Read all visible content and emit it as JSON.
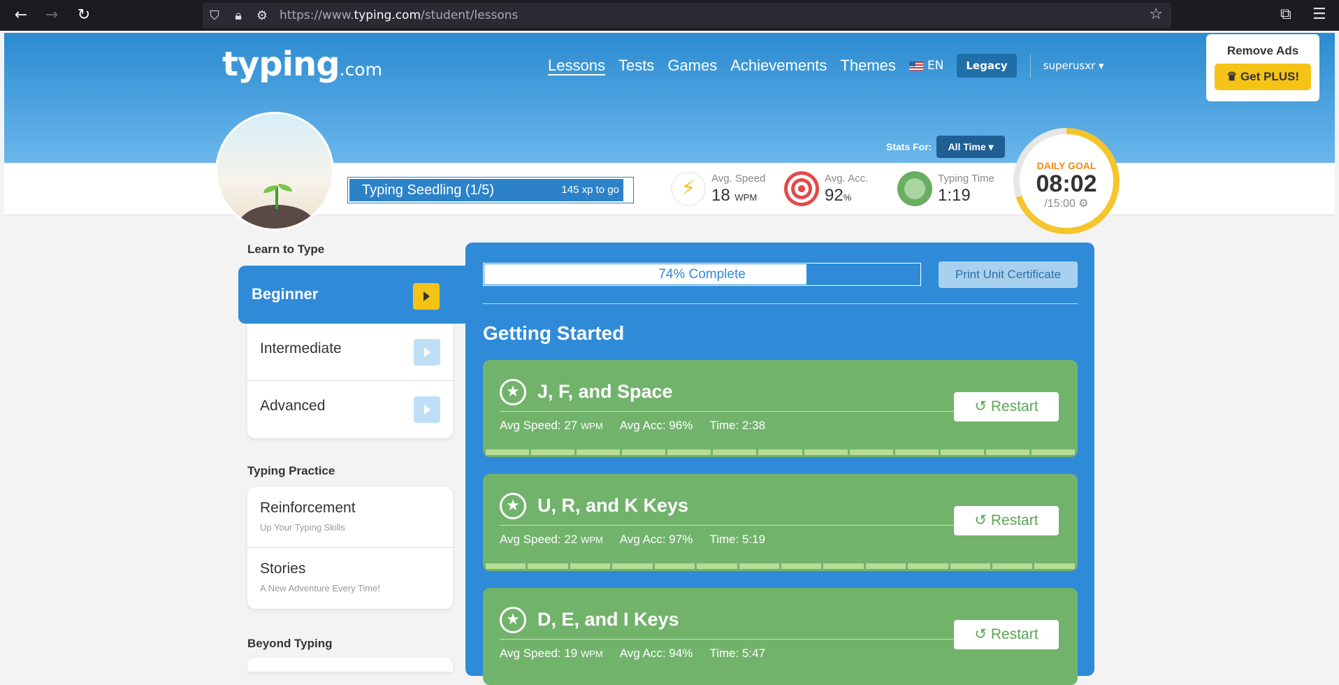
{
  "browser": {
    "url_prefix": "https://www.",
    "url_domain": "typing.com",
    "url_path": "/student/lessons"
  },
  "header": {
    "logo_main": "typing",
    "logo_suffix": ".com",
    "nav": [
      "Lessons",
      "Tests",
      "Games",
      "Achievements",
      "Themes"
    ],
    "lang": "EN",
    "legacy": "Legacy",
    "user": "superusxr",
    "remove_ads": "Remove Ads",
    "get_plus": "Get PLUS!"
  },
  "level": {
    "title": "Typing Seedling (1/5)",
    "xp": "145 xp to go",
    "progress": 0.97
  },
  "stats": {
    "stats_for_label": "Stats For:",
    "range": "All Time",
    "speed_label": "Avg. Speed",
    "speed_value": "18",
    "speed_unit": "WPM",
    "acc_label": "Avg. Acc.",
    "acc_value": "92",
    "acc_unit": "%",
    "time_label": "Typing Time",
    "time_value": "1:19"
  },
  "daily_goal": {
    "label": "DAILY GOAL",
    "time": "08:02",
    "target": "/15:00",
    "progress": 0.7
  },
  "sidebar": {
    "learn_heading": "Learn to Type",
    "levels": [
      "Beginner",
      "Intermediate",
      "Advanced"
    ],
    "practice_heading": "Typing Practice",
    "practice": [
      {
        "name": "Reinforcement",
        "sub": "Up Your Typing Skills"
      },
      {
        "name": "Stories",
        "sub": "A New Adventure Every Time!"
      }
    ],
    "beyond_heading": "Beyond Typing"
  },
  "main": {
    "progress_text": "74% Complete",
    "progress": 0.74,
    "print_button": "Print Unit Certificate",
    "section_title": "Getting Started",
    "restart_label": "Restart",
    "lessons": [
      {
        "name": "J, F, and Space",
        "speed_label": "Avg Speed: 27",
        "speed_unit": "WPM",
        "acc": "Avg Acc: 96%",
        "time": "Time: 2:38"
      },
      {
        "name": "U, R, and K Keys",
        "speed_label": "Avg Speed: 22",
        "speed_unit": "WPM",
        "acc": "Avg Acc: 97%",
        "time": "Time: 5:19"
      },
      {
        "name": "D, E, and I Keys",
        "speed_label": "Avg Speed: 19",
        "speed_unit": "WPM",
        "acc": "Avg Acc: 94%",
        "time": "Time: 5:47"
      }
    ]
  },
  "colors": {
    "primary_blue": "#2f8bd8",
    "lesson_green": "#72b36c",
    "goal_yellow": "#f5c52d",
    "plus_yellow": "#f5c216"
  }
}
